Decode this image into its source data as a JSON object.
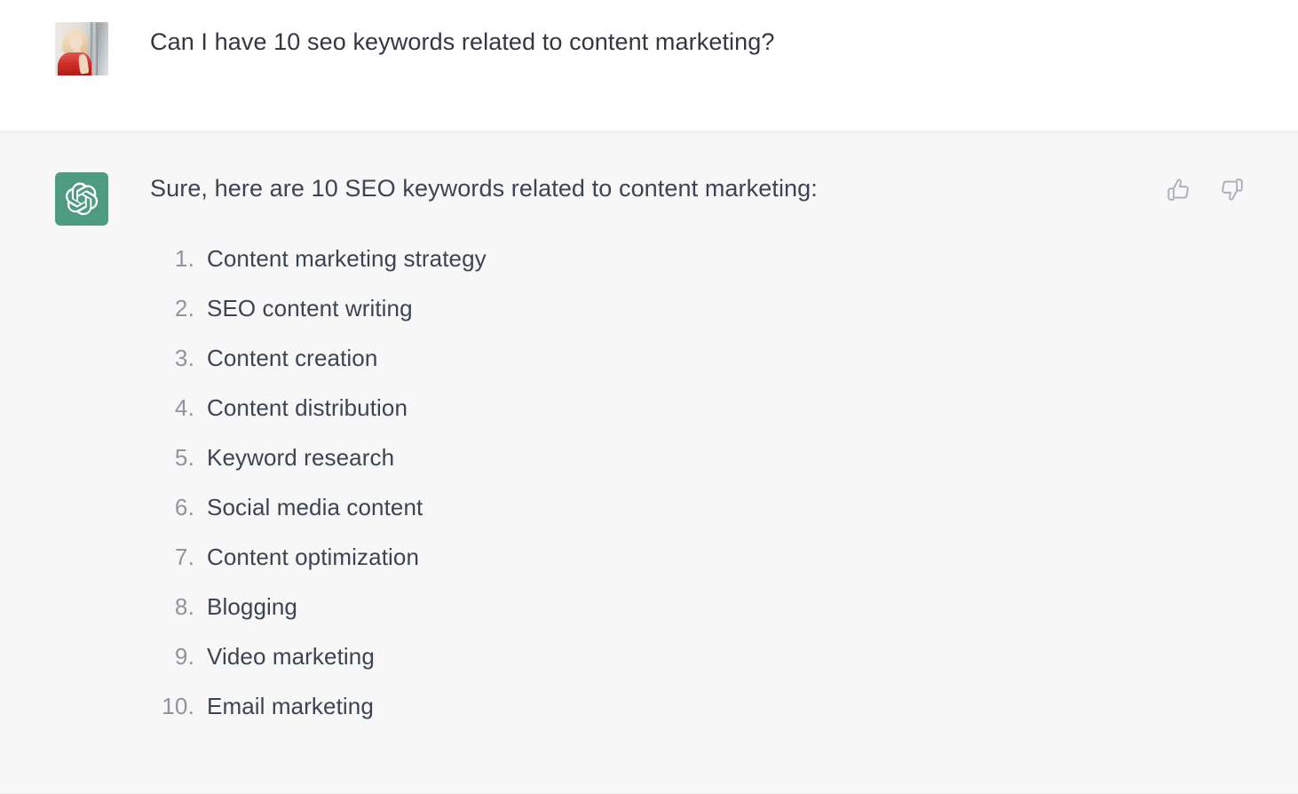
{
  "theme": {
    "user_bg": "#ffffff",
    "assistant_bg": "#f7f7f8",
    "divider": "#e5e5e5",
    "text_primary": "#3d4451",
    "text_muted": "#8f949e",
    "brand_green": "#4d9c82",
    "icon_gray": "#acb0ba"
  },
  "user_turn": {
    "avatar_alt": "user-profile-photo",
    "message": "Can I have 10 seo keywords related to content marketing?"
  },
  "assistant_turn": {
    "avatar_alt": "openai-logo",
    "message": "Sure, here are 10 SEO keywords related to content marketing:",
    "feedback": {
      "thumbs_up_label": "Good response",
      "thumbs_down_label": "Bad response"
    },
    "list": [
      {
        "num": "1.",
        "text": "Content marketing strategy"
      },
      {
        "num": "2.",
        "text": "SEO content writing"
      },
      {
        "num": "3.",
        "text": "Content creation"
      },
      {
        "num": "4.",
        "text": "Content distribution"
      },
      {
        "num": "5.",
        "text": "Keyword research"
      },
      {
        "num": "6.",
        "text": "Social media content"
      },
      {
        "num": "7.",
        "text": "Content optimization"
      },
      {
        "num": "8.",
        "text": "Blogging"
      },
      {
        "num": "9.",
        "text": "Video marketing"
      },
      {
        "num": "10.",
        "text": "Email marketing"
      }
    ]
  }
}
